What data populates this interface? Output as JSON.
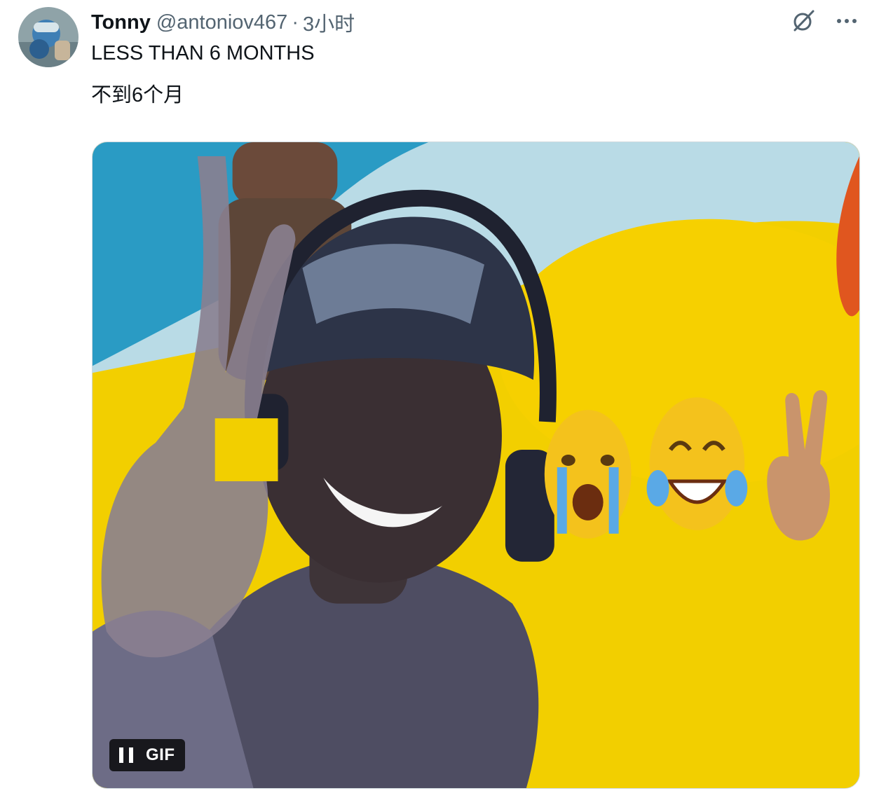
{
  "tweet": {
    "author": {
      "display_name": "Tonny",
      "handle": "@antoniov467",
      "separator": "·",
      "time": "3小时"
    },
    "text_lines": [
      "LESS THAN 6 MONTHS",
      "不到6个月"
    ],
    "actions": {
      "grok_icon": "slashed-circle-icon",
      "more_icon": "more-horizontal-icon"
    },
    "media": {
      "type": "gif",
      "badge_label": "GIF",
      "pause_icon": "pause-icon",
      "emoji_row": [
        "😭",
        "😂",
        "✌🏽"
      ]
    }
  },
  "colors": {
    "text_primary": "#0f1419",
    "text_secondary": "#536471",
    "media_yellow": "#f2cf00",
    "media_blue": "#2a9bc4"
  }
}
